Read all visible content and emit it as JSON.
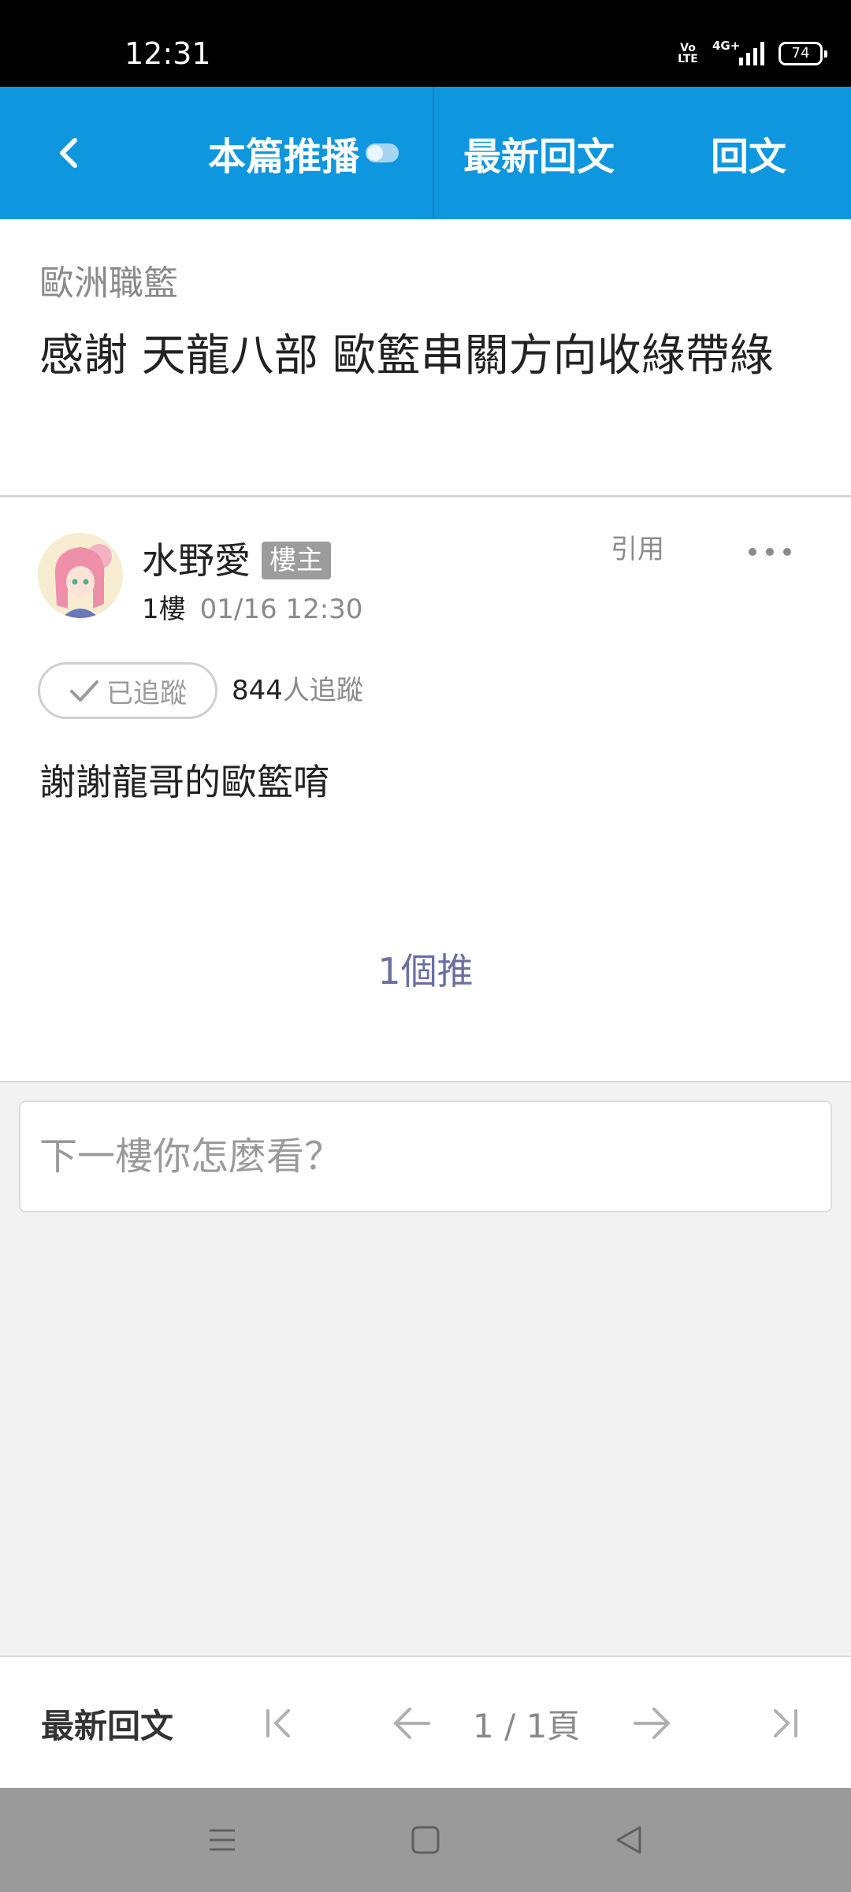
{
  "status_bar": {
    "time": "12:31",
    "volte": "Vo LTE",
    "network": "4G+",
    "battery": "74"
  },
  "top_nav": {
    "push_label": "本篇推播",
    "latest_reply_label": "最新回文",
    "reply_label": "回文"
  },
  "article": {
    "board": "歐洲職籃",
    "title": "感謝 天龍八部 歐籃串關方向收綠帶綠"
  },
  "post": {
    "author": "水野愛",
    "badge": "樓主",
    "floor": "1樓",
    "time": "01/16 12:30",
    "quote_label": "引用",
    "follow_label": "已追蹤",
    "follow_count": "844",
    "follow_suffix": "人追蹤",
    "body": "謝謝龍哥的歐籃唷",
    "push_count": "1個推"
  },
  "reply": {
    "placeholder": "下一樓你怎麼看？"
  },
  "pager": {
    "latest_label": "最新回文",
    "page_indicator": "1 / 1頁"
  },
  "colors": {
    "nav_blue": "#0e96de",
    "push_text": "#6a6fa2",
    "badge_gray": "#9c9c9c"
  }
}
